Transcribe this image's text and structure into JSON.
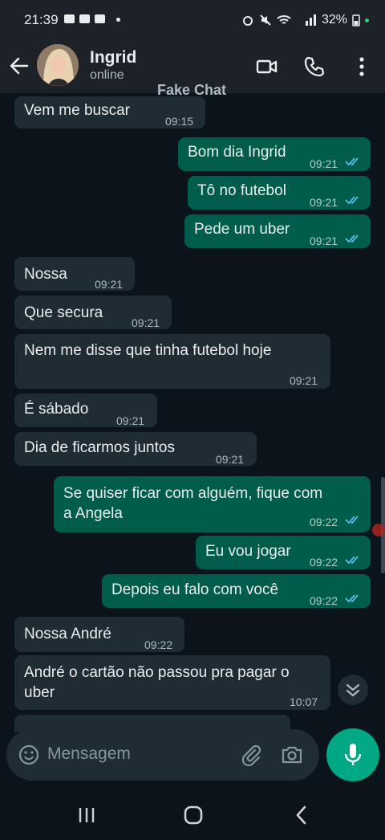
{
  "status": {
    "time": "21:39",
    "battery": "32%"
  },
  "header": {
    "contact_name": "Ingrid",
    "presence": "online"
  },
  "watermark": "Fake Chat",
  "messages": [
    {
      "direction": "in",
      "text": "Vem me buscar",
      "time": "09:15"
    },
    {
      "direction": "out",
      "text": "Bom dia Ingrid",
      "time": "09:21"
    },
    {
      "direction": "out",
      "text": "Tô no futebol",
      "time": "09:21"
    },
    {
      "direction": "out",
      "text": "Pede um uber",
      "time": "09:21"
    },
    {
      "direction": "in",
      "text": "Nossa",
      "time": "09:21"
    },
    {
      "direction": "in",
      "text": "Que secura",
      "time": "09:21"
    },
    {
      "direction": "in",
      "text": "Nem me disse que tinha futebol hoje",
      "time": "09:21"
    },
    {
      "direction": "in",
      "text": "É sábado",
      "time": "09:21"
    },
    {
      "direction": "in",
      "text": "Dia de ficarmos juntos",
      "time": "09:21"
    },
    {
      "direction": "out",
      "text": "Se quiser ficar com alguém, fique com",
      "text2": "a Angela",
      "time": "09:22"
    },
    {
      "direction": "out",
      "text": "Eu vou jogar",
      "time": "09:22"
    },
    {
      "direction": "out",
      "text": "Depois eu falo com você",
      "time": "09:22"
    },
    {
      "direction": "in",
      "text": "Nossa André",
      "time": "09:22"
    },
    {
      "direction": "in",
      "text": "André o cartão não passou pra pagar o",
      "text2": "uber",
      "time": "10:07"
    }
  ],
  "composer": {
    "placeholder": "Mensagem"
  },
  "colors": {
    "incoming": "#202c33",
    "outgoing": "#005c4b",
    "accent": "#00a884",
    "read_ticks": "#53bdeb"
  },
  "icons": [
    "back-arrow-icon",
    "video-call-icon",
    "phone-icon",
    "more-options-icon",
    "emoji-icon",
    "attach-icon",
    "camera-icon",
    "mic-icon",
    "scroll-down-icon",
    "nav-recents-icon",
    "nav-home-icon",
    "nav-back-icon"
  ]
}
